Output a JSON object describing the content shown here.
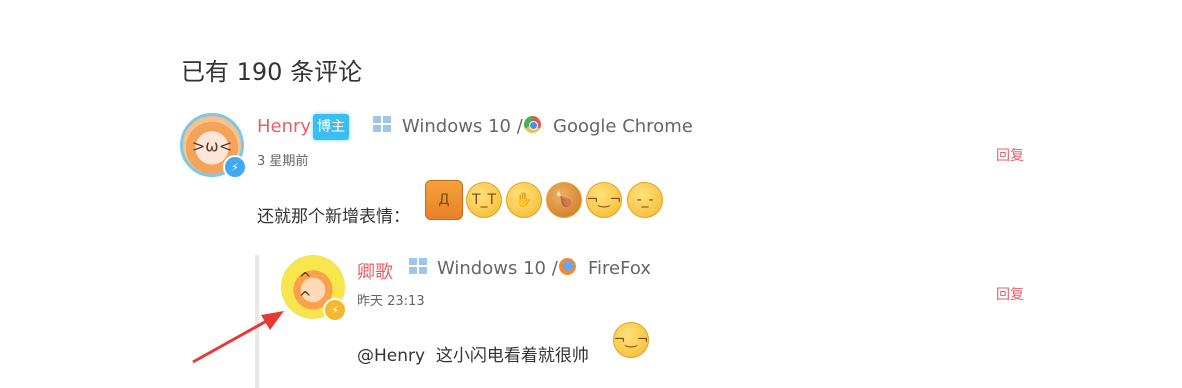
{
  "comments_heading": "已有 190 条评论",
  "comment1": {
    "author": "Henry",
    "badge": "博主",
    "os": "Windows 10 /",
    "browser": "Google Chrome",
    "time": "3 星期前",
    "reply_label": "回复",
    "text": "还就那个新增表情：",
    "emojis": [
      "surprised-emoji",
      "crying-emoji",
      "facepalm-emoji",
      "drumstick-emoji",
      "smirk-emoji",
      "thinking-emoji"
    ],
    "avatar_icon": "anime-avatar",
    "verified_icon": "lightning-icon",
    "verified_color": "#3fa9f5"
  },
  "comment2": {
    "author": "卿歌",
    "os": "Windows 10 /",
    "browser": "FireFox",
    "time": "昨天 23:13",
    "reply_label": "回复",
    "mention": "@Henry",
    "text": "这小闪电看着就很帅",
    "emojis": [
      "smirk-emoji"
    ],
    "avatar_icon": "anime-avatar",
    "verified_icon": "lightning-icon",
    "verified_color": "#f5b82e"
  },
  "colors": {
    "accent": "#e6606a",
    "badge": "#3bbdf0",
    "annotation_arrow": "#e53935"
  }
}
